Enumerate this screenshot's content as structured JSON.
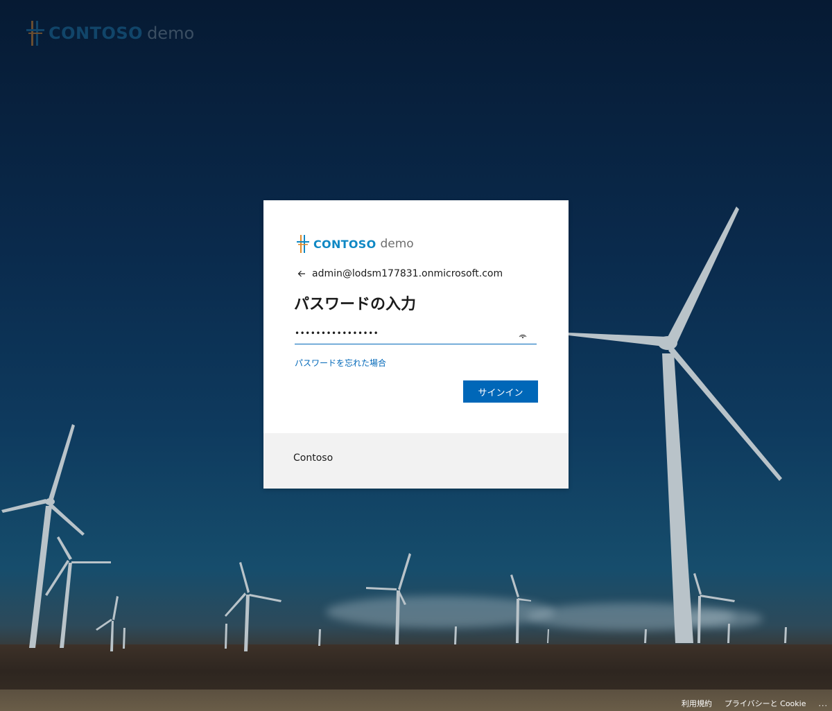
{
  "background": {
    "sky_top": "#061a33",
    "sky_mid": "#0e3a5e",
    "ground": "#2e2620"
  },
  "top_logo": {
    "brand": "CONTOSO",
    "suffix": "demo",
    "icon": "contoso-logo-icon"
  },
  "card": {
    "logo": {
      "brand": "CONTOSO",
      "suffix": "demo",
      "icon": "contoso-logo-icon"
    },
    "identity": {
      "back_icon": "arrow-left-icon",
      "email": "admin@lodsm177831.onmicrosoft.com"
    },
    "title": "パスワードの入力",
    "password": {
      "value": "••••••••••••••••",
      "reveal_icon": "eye-icon"
    },
    "forgot_link": "パスワードを忘れた場合",
    "signin_button": "サインイン",
    "footer": {
      "tenant": "Contoso"
    },
    "accent": "#0067b8"
  },
  "page_footer": {
    "terms": "利用規約",
    "privacy": "プライバシーと Cookie",
    "more": "..."
  }
}
